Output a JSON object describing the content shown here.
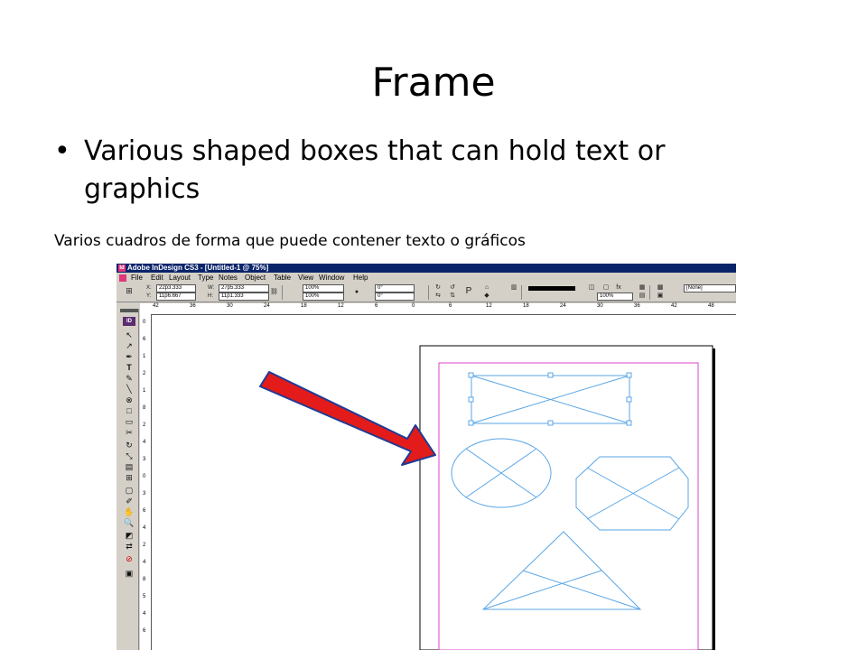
{
  "slide": {
    "title": "Frame",
    "bullet": "Various shaped boxes that can hold text or graphics",
    "subtitle": "Varios cuadros de forma que puede contener texto o gráficos"
  },
  "app": {
    "title_bar": "Adobe InDesign CS3 - [Untitled-1 @ 75%]",
    "menu": [
      "File",
      "Edit",
      "Layout",
      "Type",
      "Notes",
      "Object",
      "Table",
      "View",
      "Window",
      "Help"
    ],
    "control": {
      "x_label": "X:",
      "x_value": "22p3.333",
      "y_label": "Y:",
      "y_value": "11p6.667",
      "w_label": "W:",
      "w_value": "27p5.333",
      "h_label": "H:",
      "h_value": "11p1.333",
      "scale_x": "100%",
      "scale_y": "100%",
      "rotate": "0°",
      "shear": "0°",
      "stroke_weight": "100%",
      "style": "[None]"
    },
    "ruler_top": [
      "42",
      "36",
      "30",
      "24",
      "18",
      "12",
      "6",
      "0",
      "6",
      "12",
      "18",
      "24",
      "30",
      "36",
      "42",
      "48"
    ],
    "ruler_left": [
      "0",
      "6",
      "1",
      "2",
      "1",
      "8",
      "2",
      "4",
      "3",
      "0",
      "3",
      "6",
      "4",
      "2",
      "4",
      "8",
      "5",
      "4",
      "6"
    ],
    "toolbox_id": "ID",
    "colors": {
      "frame_stroke": "#5aa6e6",
      "margin_guide": "#d946c8",
      "arrow_fill": "#e31b1b",
      "arrow_outline": "#1f3a93",
      "titlebar": "#0a246a"
    }
  }
}
